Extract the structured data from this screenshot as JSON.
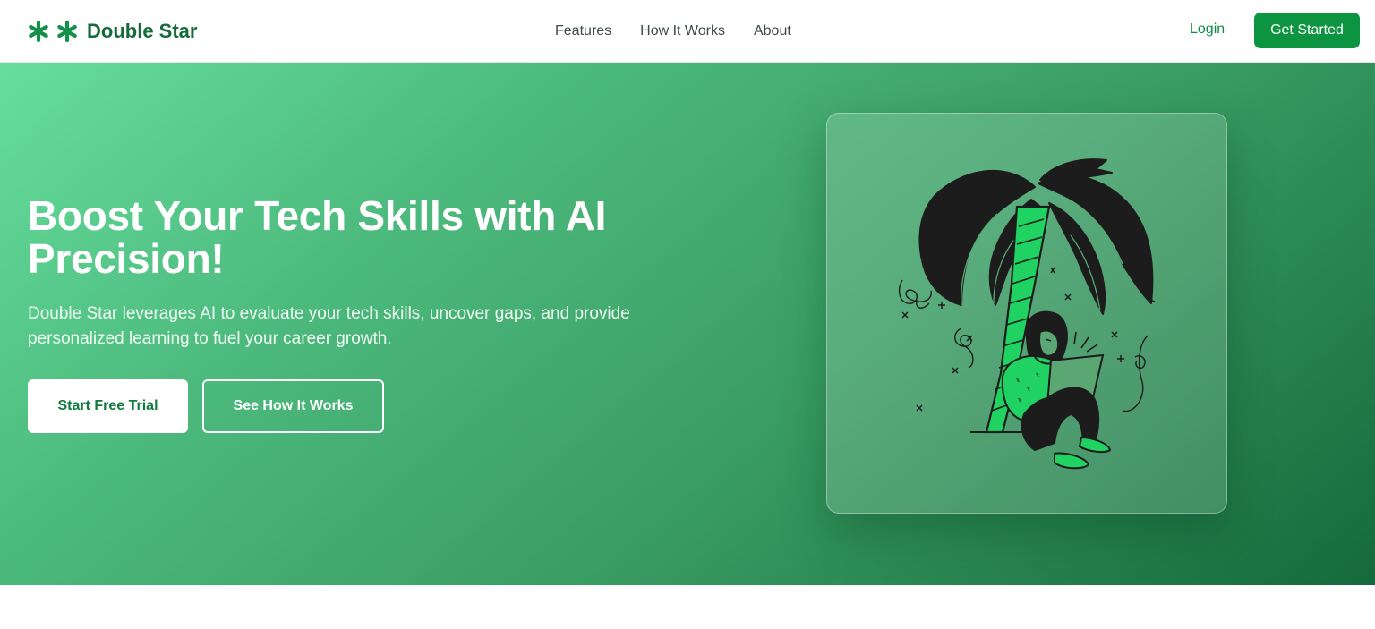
{
  "header": {
    "brand": {
      "name": "Double Star",
      "icon": "asterisk-icon"
    },
    "nav": [
      {
        "label": "Features"
      },
      {
        "label": "How It Works"
      },
      {
        "label": "About"
      }
    ],
    "login_label": "Login",
    "cta_label": "Get Started"
  },
  "hero": {
    "title": "Boost Your Tech Skills with AI Precision!",
    "subtitle": "Double Star leverages AI to evaluate your tech skills, uncover gaps, and provide personalized learning to fuel your career growth.",
    "primary_button": "Start Free Trial",
    "secondary_button": "See How It Works",
    "illustration": "person-with-laptop-under-palm-tree-illustration"
  },
  "colors": {
    "brand_green": "#166b3c",
    "accent_green": "#0c9440",
    "hero_gradient_start": "#66de9c",
    "hero_gradient_end": "#146a3c"
  }
}
